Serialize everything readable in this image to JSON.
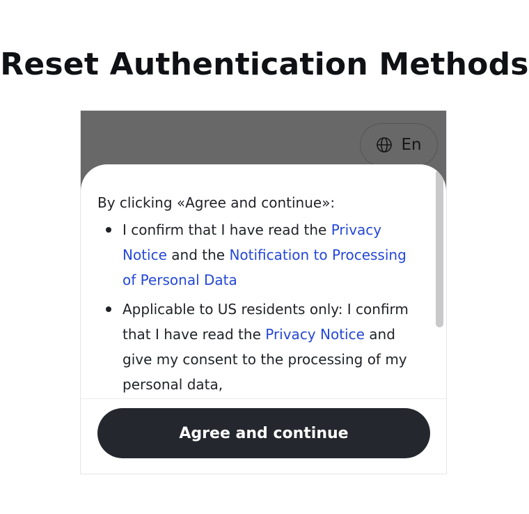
{
  "page": {
    "title": "Reset Authentication Methods"
  },
  "language_button": {
    "icon": "globe-icon",
    "label": "En"
  },
  "consent": {
    "intro": "By clicking «Agree and continue»:",
    "item1": {
      "before": "I confirm that I have read the ",
      "link1": "Privacy Notice",
      "middle": " and the ",
      "link2": "Notification to Processing of Personal Data"
    },
    "item2": {
      "before": "Applicable to US residents only: I confirm that I have read the ",
      "link1": "Privacy Notice",
      "after": " and give my consent to the processing of my personal data,"
    }
  },
  "footer": {
    "agree_label": "Agree and continue"
  },
  "colors": {
    "overlay": "#686868",
    "link": "#2447d8",
    "primary_button": "#24272d"
  }
}
